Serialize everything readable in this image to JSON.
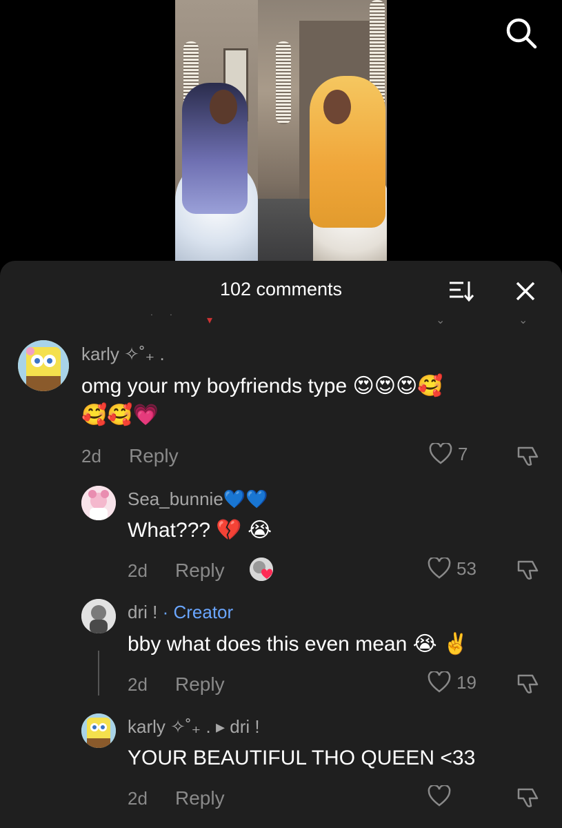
{
  "header": {
    "comments_count": "102 comments"
  },
  "comments": [
    {
      "username": "karly ✧˚₊ .",
      "text": "omg your my boyfriends type 😍😍😍🥰",
      "text2": "🥰🥰💗",
      "time": "2d",
      "reply_label": "Reply",
      "likes": "7"
    },
    {
      "username": "Sea_bunnie💙💙",
      "text": "What??? 💔 😭",
      "time": "2d",
      "reply_label": "Reply",
      "likes": "53"
    },
    {
      "username": "dri !",
      "creator_label": "· Creator",
      "text": "bby what does this even mean 😭 ✌️",
      "time": "2d",
      "reply_label": "Reply",
      "likes": "19"
    },
    {
      "username": "karly ✧˚₊ .",
      "reply_to": "▸ dri !",
      "text": "YOUR BEAUTIFUL THO QUEEN <33",
      "time": "2d",
      "reply_label": "Reply",
      "likes": ""
    }
  ],
  "colors": {
    "sheet": "#1f1f1f",
    "creator": "#6aa6ff",
    "muted": "#8a8a8a"
  }
}
